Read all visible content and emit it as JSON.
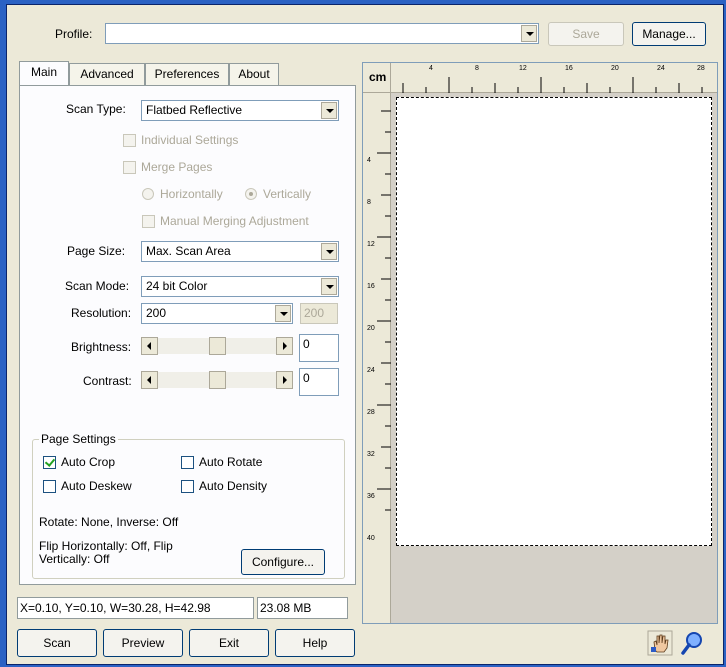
{
  "profile": {
    "label": "Profile:",
    "value": "",
    "save_label": "Save",
    "manage_label": "Manage..."
  },
  "tabs": [
    "Main",
    "Advanced",
    "Preferences",
    "About"
  ],
  "main": {
    "scan_type": {
      "label": "Scan Type:",
      "value": "Flatbed Reflective"
    },
    "individual_settings": "Individual Settings",
    "merge_pages": "Merge Pages",
    "horizontally": "Horizontally",
    "vertically": "Vertically",
    "manual_merging": "Manual Merging Adjustment",
    "page_size": {
      "label": "Page Size:",
      "value": "Max. Scan Area"
    },
    "scan_mode": {
      "label": "Scan Mode:",
      "value": "24 bit Color"
    },
    "resolution": {
      "label": "Resolution:",
      "value": "200",
      "custom": "200"
    },
    "brightness": {
      "label": "Brightness:",
      "value": "0",
      "level": 0.5
    },
    "contrast": {
      "label": "Contrast:",
      "value": "0",
      "level": 0.5
    }
  },
  "page_settings": {
    "title": "Page Settings",
    "auto_crop": "Auto Crop",
    "auto_rotate": "Auto Rotate",
    "auto_deskew": "Auto Deskew",
    "auto_density": "Auto Density",
    "rotate_info": "Rotate: None, Inverse: Off",
    "flip_info_1": "Flip Horizontally: Off, Flip",
    "flip_info_2": "Vertically: Off",
    "configure_label": "Configure..."
  },
  "status": {
    "coords": "X=0.10, Y=0.10, W=30.28, H=42.98",
    "size": "23.08 MB"
  },
  "buttons": {
    "scan": "Scan",
    "preview": "Preview",
    "exit": "Exit",
    "help": "Help"
  },
  "ruler": {
    "unit": "cm",
    "top_ticks": [
      "4",
      "8",
      "12",
      "16",
      "20",
      "24",
      "28"
    ],
    "left_ticks": [
      "4",
      "8",
      "12",
      "16",
      "20",
      "24",
      "28",
      "32",
      "36",
      "40"
    ]
  },
  "icons": {
    "hand": "hand-icon",
    "zoom": "zoom-icon"
  },
  "colors": {
    "accent": "#0a246a",
    "check": "#21a121",
    "disabled": "#aca899"
  }
}
